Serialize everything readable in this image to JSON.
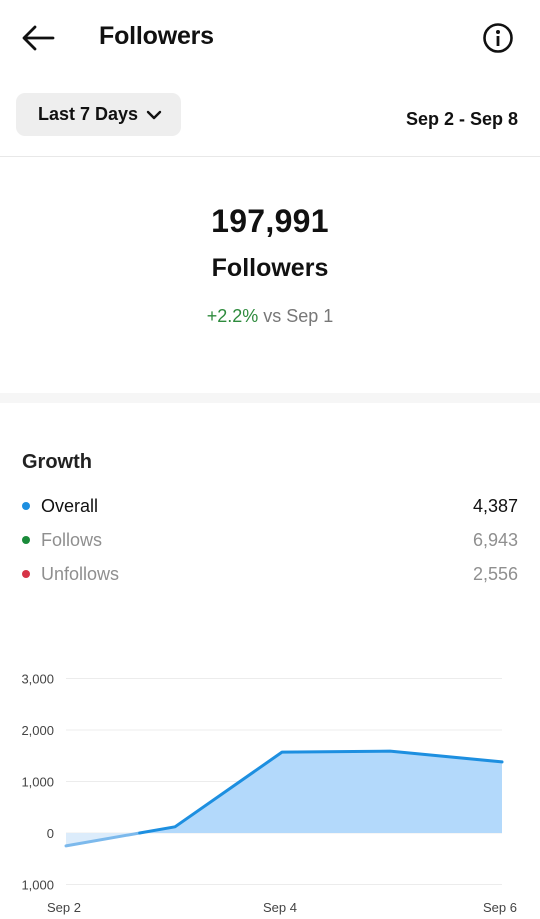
{
  "header": {
    "title": "Followers",
    "back_icon": "arrow-left-icon",
    "info_icon": "info-circle-icon"
  },
  "filter": {
    "range_label": "Last 7 Days",
    "date_range": "Sep 2 - Sep 8"
  },
  "summary": {
    "count": "197,991",
    "label": "Followers",
    "change": "+2.2%",
    "comparison": "vs Sep 1"
  },
  "growth": {
    "title": "Growth",
    "items": [
      {
        "name": "Overall",
        "value": "4,387",
        "color": "#1d8fe0"
      },
      {
        "name": "Follows",
        "value": "6,943",
        "color": "#1a8a3a"
      },
      {
        "name": "Unfollows",
        "value": "2,556",
        "color": "#d63447"
      }
    ]
  },
  "chart_data": {
    "type": "area",
    "series": [
      {
        "name": "Overall",
        "x": [
          "Sep 2",
          "Sep 3",
          "Sep 4",
          "Sep 5",
          "Sep 6"
        ],
        "values": [
          -250,
          120,
          1570,
          1590,
          1380
        ]
      }
    ],
    "y_ticks": [
      "3,000",
      "2,000",
      "1,000",
      "0",
      "1,000"
    ],
    "x_ticks": [
      "Sep 2",
      "Sep 4",
      "Sep 6"
    ],
    "ylim": [
      -1000,
      3000
    ],
    "grid": true,
    "line_color": "#1d8fe0",
    "fill_color": "#b3d9fb"
  }
}
